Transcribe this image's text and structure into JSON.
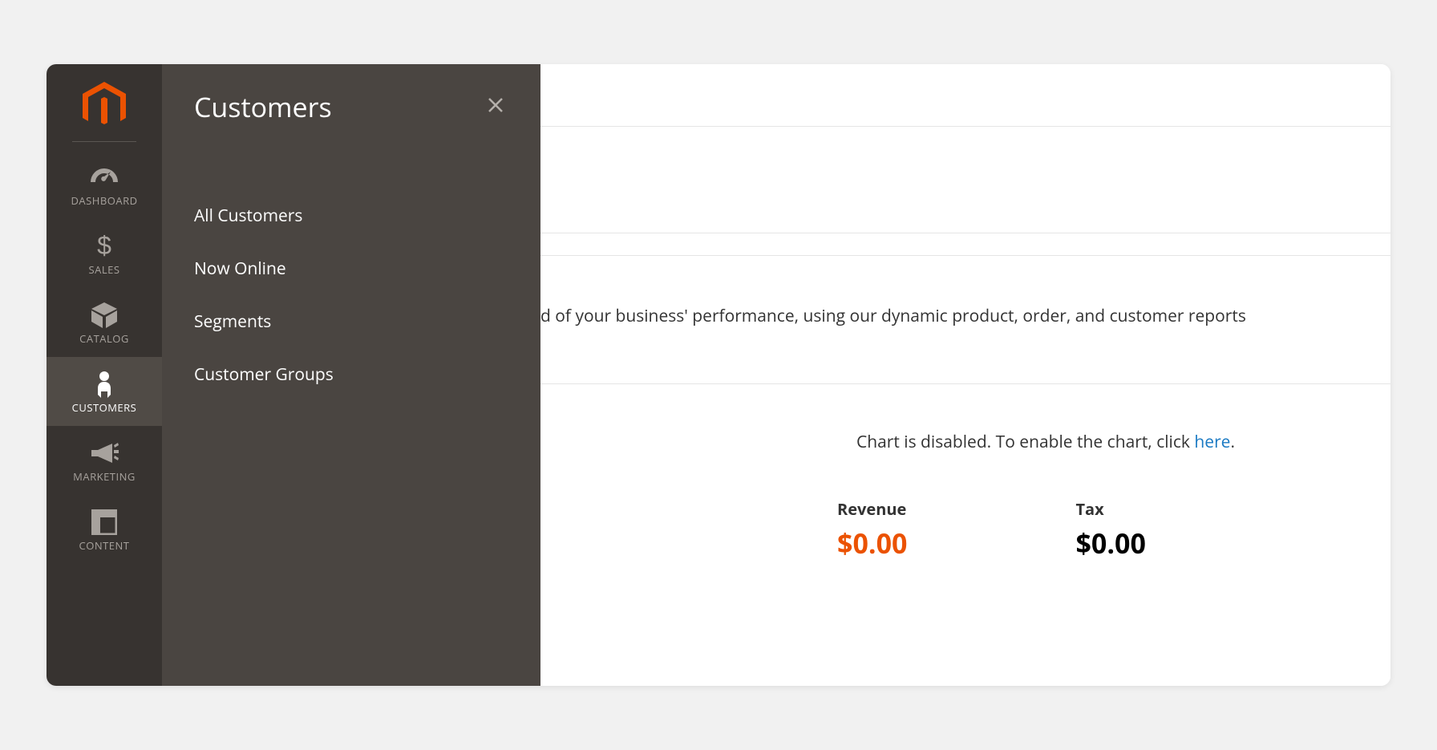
{
  "sidebar": {
    "items": [
      {
        "label": "DASHBOARD"
      },
      {
        "label": "SALES"
      },
      {
        "label": "CATALOG"
      },
      {
        "label": "CUSTOMERS"
      },
      {
        "label": "MARKETING"
      },
      {
        "label": "CONTENT"
      }
    ]
  },
  "flyout": {
    "title": "Customers",
    "items": [
      {
        "label": "All Customers"
      },
      {
        "label": "Now Online"
      },
      {
        "label": "Segments"
      },
      {
        "label": "Customer Groups"
      }
    ]
  },
  "content": {
    "info_text": "d of your business' performance, using our dynamic product, order, and customer reports",
    "chart_msg_prefix": "Chart is disabled. To enable the chart, click ",
    "chart_msg_link": "here",
    "chart_msg_suffix": ".",
    "stats": {
      "revenue_label": "Revenue",
      "revenue_value": "$0.00",
      "tax_label": "Tax",
      "tax_value": "$0.00"
    }
  }
}
